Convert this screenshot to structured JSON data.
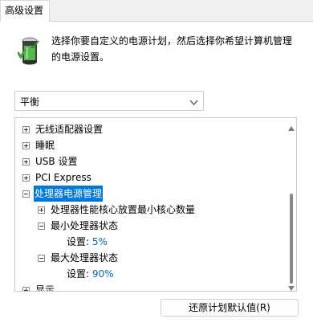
{
  "tabs": [
    {
      "label": "高级设置"
    }
  ],
  "header": {
    "icon": "power-options-battery-icon",
    "description": "选择你要自定义的电源计划，然后选择你希望计算机管理的电源设置。"
  },
  "plan_select": {
    "value": "平衡"
  },
  "tree": {
    "items": [
      {
        "label": "无线适配器设置",
        "toggle": "+"
      },
      {
        "label": "睡眠",
        "toggle": "+"
      },
      {
        "label": "USB 设置",
        "toggle": "+"
      },
      {
        "label": "PCI Express",
        "toggle": "+"
      },
      {
        "label": "处理器电源管理",
        "toggle": "−",
        "selected": true
      },
      {
        "label": "处理器性能核心放置最小核心数量",
        "toggle": "+"
      },
      {
        "label": "最小处理器状态",
        "toggle": "−"
      },
      {
        "setting_label": "设置:",
        "setting_value": "5%"
      },
      {
        "label": "最大处理器状态",
        "toggle": "−"
      },
      {
        "setting_label": "设置:",
        "setting_value": "90%"
      },
      {
        "label": "显示",
        "toggle": "+"
      }
    ]
  },
  "colors": {
    "selection": "#0078d7",
    "setting_value": "#0067c0"
  },
  "buttons": {
    "restore_label": "还原计划默认值(R)"
  }
}
